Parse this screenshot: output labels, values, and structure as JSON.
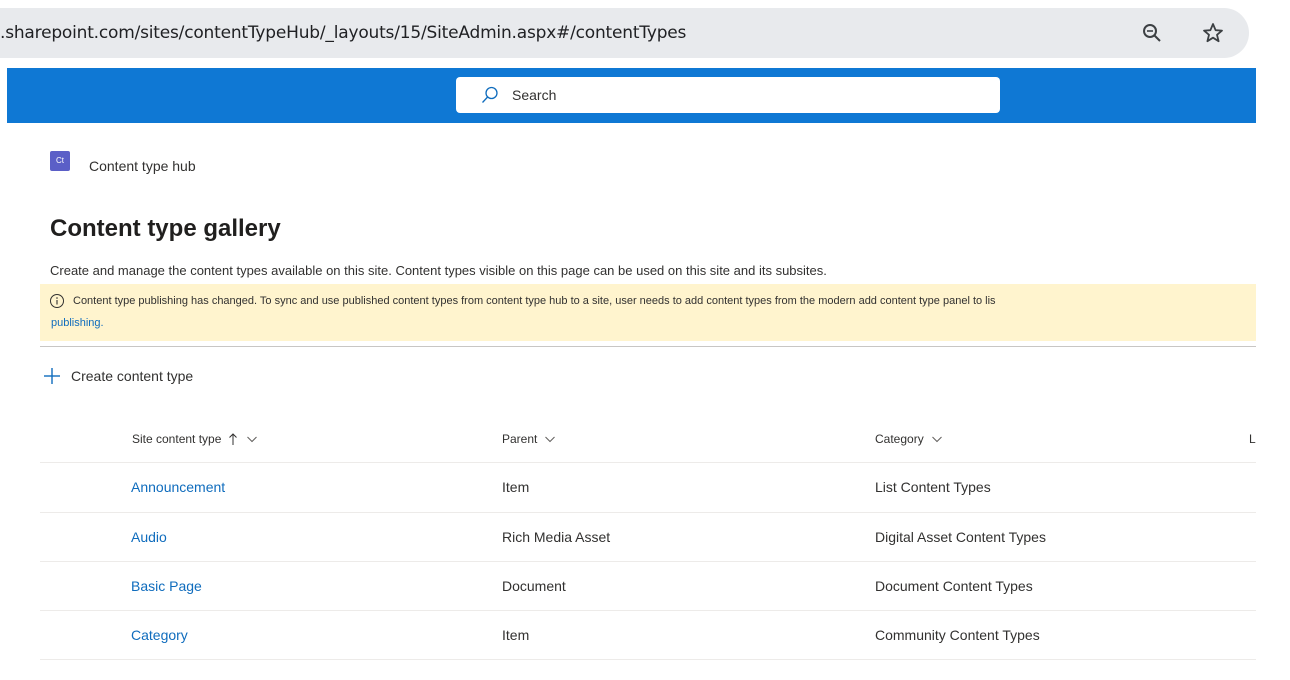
{
  "browser": {
    "url": ".sharepoint.com/sites/contentTypeHub/_layouts/15/SiteAdmin.aspx#/contentTypes",
    "zoom_icon": "zoom-icon",
    "bookmark_icon": "star-icon"
  },
  "suite_bar": {
    "color": "#0f78d4",
    "search_placeholder": "Search"
  },
  "site": {
    "logo_text": "Ct",
    "name": "Content type hub",
    "logo_color": "#5b5fc7"
  },
  "page": {
    "title": "Content type gallery",
    "description": "Create and manage the content types available on this site. Content types visible on this page can be used on this site and its subsites."
  },
  "banner": {
    "text": "Content type publishing has changed. To sync and use published content types from content type hub to a site, user needs to add content types from the modern add content type panel to lis",
    "link": "publishing.",
    "color": "#fff4ce"
  },
  "toolbar": {
    "create_label": "Create content type"
  },
  "table": {
    "columns": [
      {
        "label": "Site content type",
        "sorted": "ascending"
      },
      {
        "label": "Parent"
      },
      {
        "label": "Category"
      },
      {
        "label": "L"
      }
    ],
    "rows": [
      {
        "name": "Announcement",
        "parent": "Item",
        "category": "List Content Types"
      },
      {
        "name": "Audio",
        "parent": "Rich Media Asset",
        "category": "Digital Asset Content Types"
      },
      {
        "name": "Basic Page",
        "parent": "Document",
        "category": "Document Content Types"
      },
      {
        "name": "Category",
        "parent": "Item",
        "category": "Community Content Types"
      }
    ]
  }
}
